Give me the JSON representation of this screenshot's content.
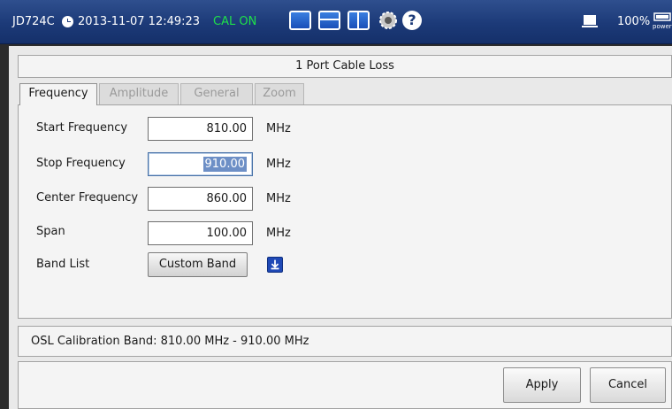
{
  "titlebar": {
    "model": "JD724C",
    "datetime": "2013-11-07 12:49:23",
    "cal_status": "CAL ON",
    "battery": "100%",
    "power_label": "power",
    "icons": [
      "clock-icon",
      "single-view-icon",
      "split-horizontal-icon",
      "split-vertical-icon",
      "gear-icon",
      "help-icon",
      "laptop-icon",
      "power-icon"
    ],
    "help_glyph": "?"
  },
  "dialog": {
    "title": "1 Port Cable Loss",
    "tabs": [
      "Frequency",
      "Amplitude",
      "General",
      "Zoom"
    ],
    "active_tab": "Frequency"
  },
  "fields": {
    "start": {
      "label": "Start Frequency",
      "value": "810.00",
      "unit": "MHz"
    },
    "stop": {
      "label": "Stop Frequency",
      "value": "910.00",
      "unit": "MHz"
    },
    "center": {
      "label": "Center Frequency",
      "value": "860.00",
      "unit": "MHz"
    },
    "span": {
      "label": "Span",
      "value": "100.00",
      "unit": "MHz"
    }
  },
  "band_list": {
    "label": "Band List",
    "button": "Custom Band"
  },
  "cal_band": "OSL Calibration Band: 810.00 MHz - 910.00 MHz",
  "buttons": {
    "apply": "Apply",
    "cancel": "Cancel"
  },
  "colors": {
    "titlebar": "#1c3a78",
    "cal_on": "#1fe04a",
    "selection": "#6d8fc6"
  }
}
